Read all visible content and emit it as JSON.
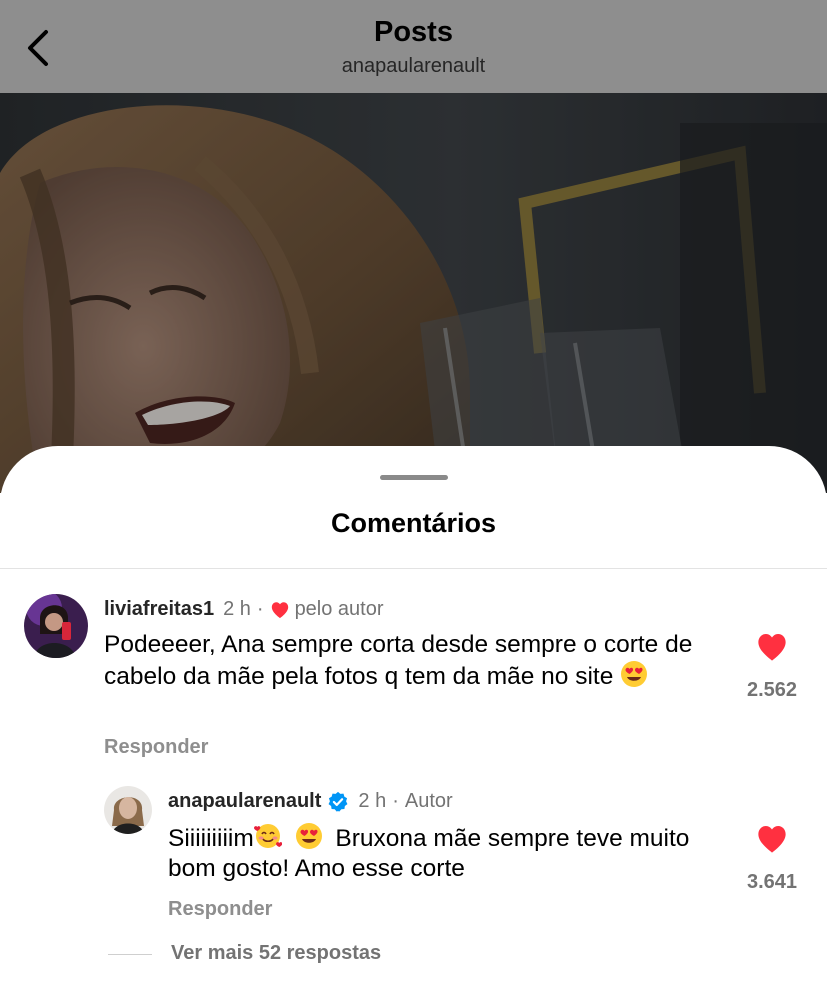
{
  "header": {
    "title": "Posts",
    "subtitle": "anapaularenault"
  },
  "sheet": {
    "title": "Comentários"
  },
  "comments": [
    {
      "username": "liviafreitas1",
      "time": "2 h",
      "separator": "·",
      "liked_by_author_label": "pelo autor",
      "text": "Podeeeer, Ana sempre corta desde sempre o corte de cabelo da mãe pela fotos q tem da mãe no site",
      "emoji": "smiling-face-with-heart-eyes",
      "reply_label": "Responder",
      "likes": "2.562",
      "liked": true
    },
    {
      "username": "anapaularenault",
      "verified": true,
      "time": "2 h",
      "separator": "·",
      "author_label": "Autor",
      "text_start": "Siiiiiiiiim",
      "text_end": "Bruxona mãe sempre teve muito bom gosto! Amo esse corte",
      "emojis": [
        "smiling-face-with-hearts",
        "smiling-face-with-heart-eyes"
      ],
      "reply_label": "Responder",
      "likes": "3.641",
      "liked": true
    }
  ],
  "more_replies": "Ver mais 52 respostas",
  "colors": {
    "header_bg": "#8e8e8e",
    "like_red": "#ff3040",
    "verified_blue": "#0095f6",
    "muted_text": "#737373"
  }
}
